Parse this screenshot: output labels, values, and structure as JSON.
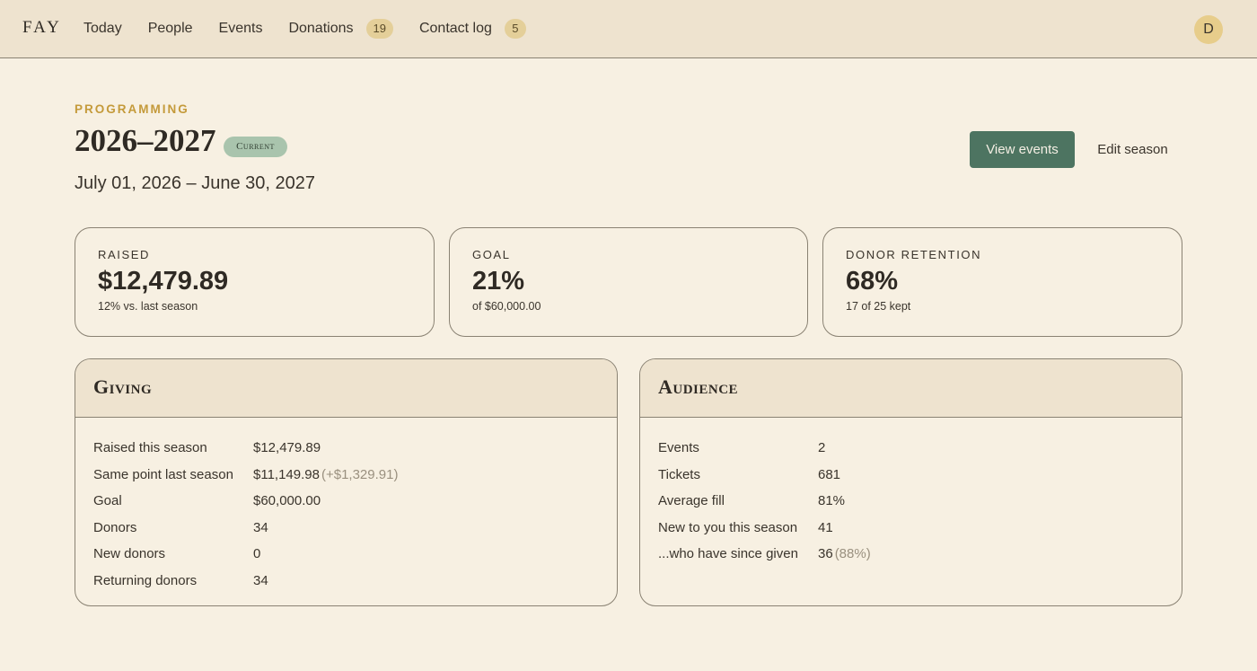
{
  "nav": {
    "logo": "FAY",
    "items": [
      {
        "label": "Today"
      },
      {
        "label": "People"
      },
      {
        "label": "Events"
      },
      {
        "label": "Donations",
        "badge": "19"
      },
      {
        "label": "Contact log",
        "badge": "5"
      }
    ],
    "avatar_initial": "D"
  },
  "header": {
    "eyebrow": "PROGRAMMING",
    "title": "2026–2027",
    "status_pill": "Current",
    "date_range": "July 01, 2026 – June 30, 2027",
    "primary_button": "View events",
    "secondary_button": "Edit season"
  },
  "stats": [
    {
      "label": "RAISED",
      "value": "$12,479.89",
      "sub": "12% vs. last season"
    },
    {
      "label": "GOAL",
      "value": "21%",
      "sub": "of $60,000.00"
    },
    {
      "label": "DONOR RETENTION",
      "value": "68%",
      "sub": "17 of 25 kept"
    }
  ],
  "giving": {
    "title": "Giving",
    "rows": [
      {
        "label": "Raised this season",
        "value": "$12,479.89",
        "extra": ""
      },
      {
        "label": "Same point last season",
        "value": "$11,149.98",
        "extra": "(+$1,329.91)"
      },
      {
        "label": "Goal",
        "value": "$60,000.00",
        "extra": ""
      },
      {
        "label": "Donors",
        "value": "34",
        "extra": ""
      },
      {
        "label": "New donors",
        "value": "0",
        "extra": ""
      },
      {
        "label": "Returning donors",
        "value": "34",
        "extra": ""
      }
    ]
  },
  "audience": {
    "title": "Audience",
    "rows": [
      {
        "label": "Events",
        "value": "2",
        "extra": ""
      },
      {
        "label": "Tickets",
        "value": "681",
        "extra": ""
      },
      {
        "label": "Average fill",
        "value": "81%",
        "extra": ""
      },
      {
        "label": "New to you this season",
        "value": "41",
        "extra": ""
      },
      {
        "label": "...who have since given",
        "value": "36",
        "extra": "(88%)"
      }
    ]
  },
  "colors": {
    "accent": "#4d7461",
    "eyebrow": "#c49a3a",
    "badge": "#e4cf99",
    "pill": "#a9c4ad",
    "background": "#f7f0e2",
    "header_band": "#eee3cf"
  }
}
